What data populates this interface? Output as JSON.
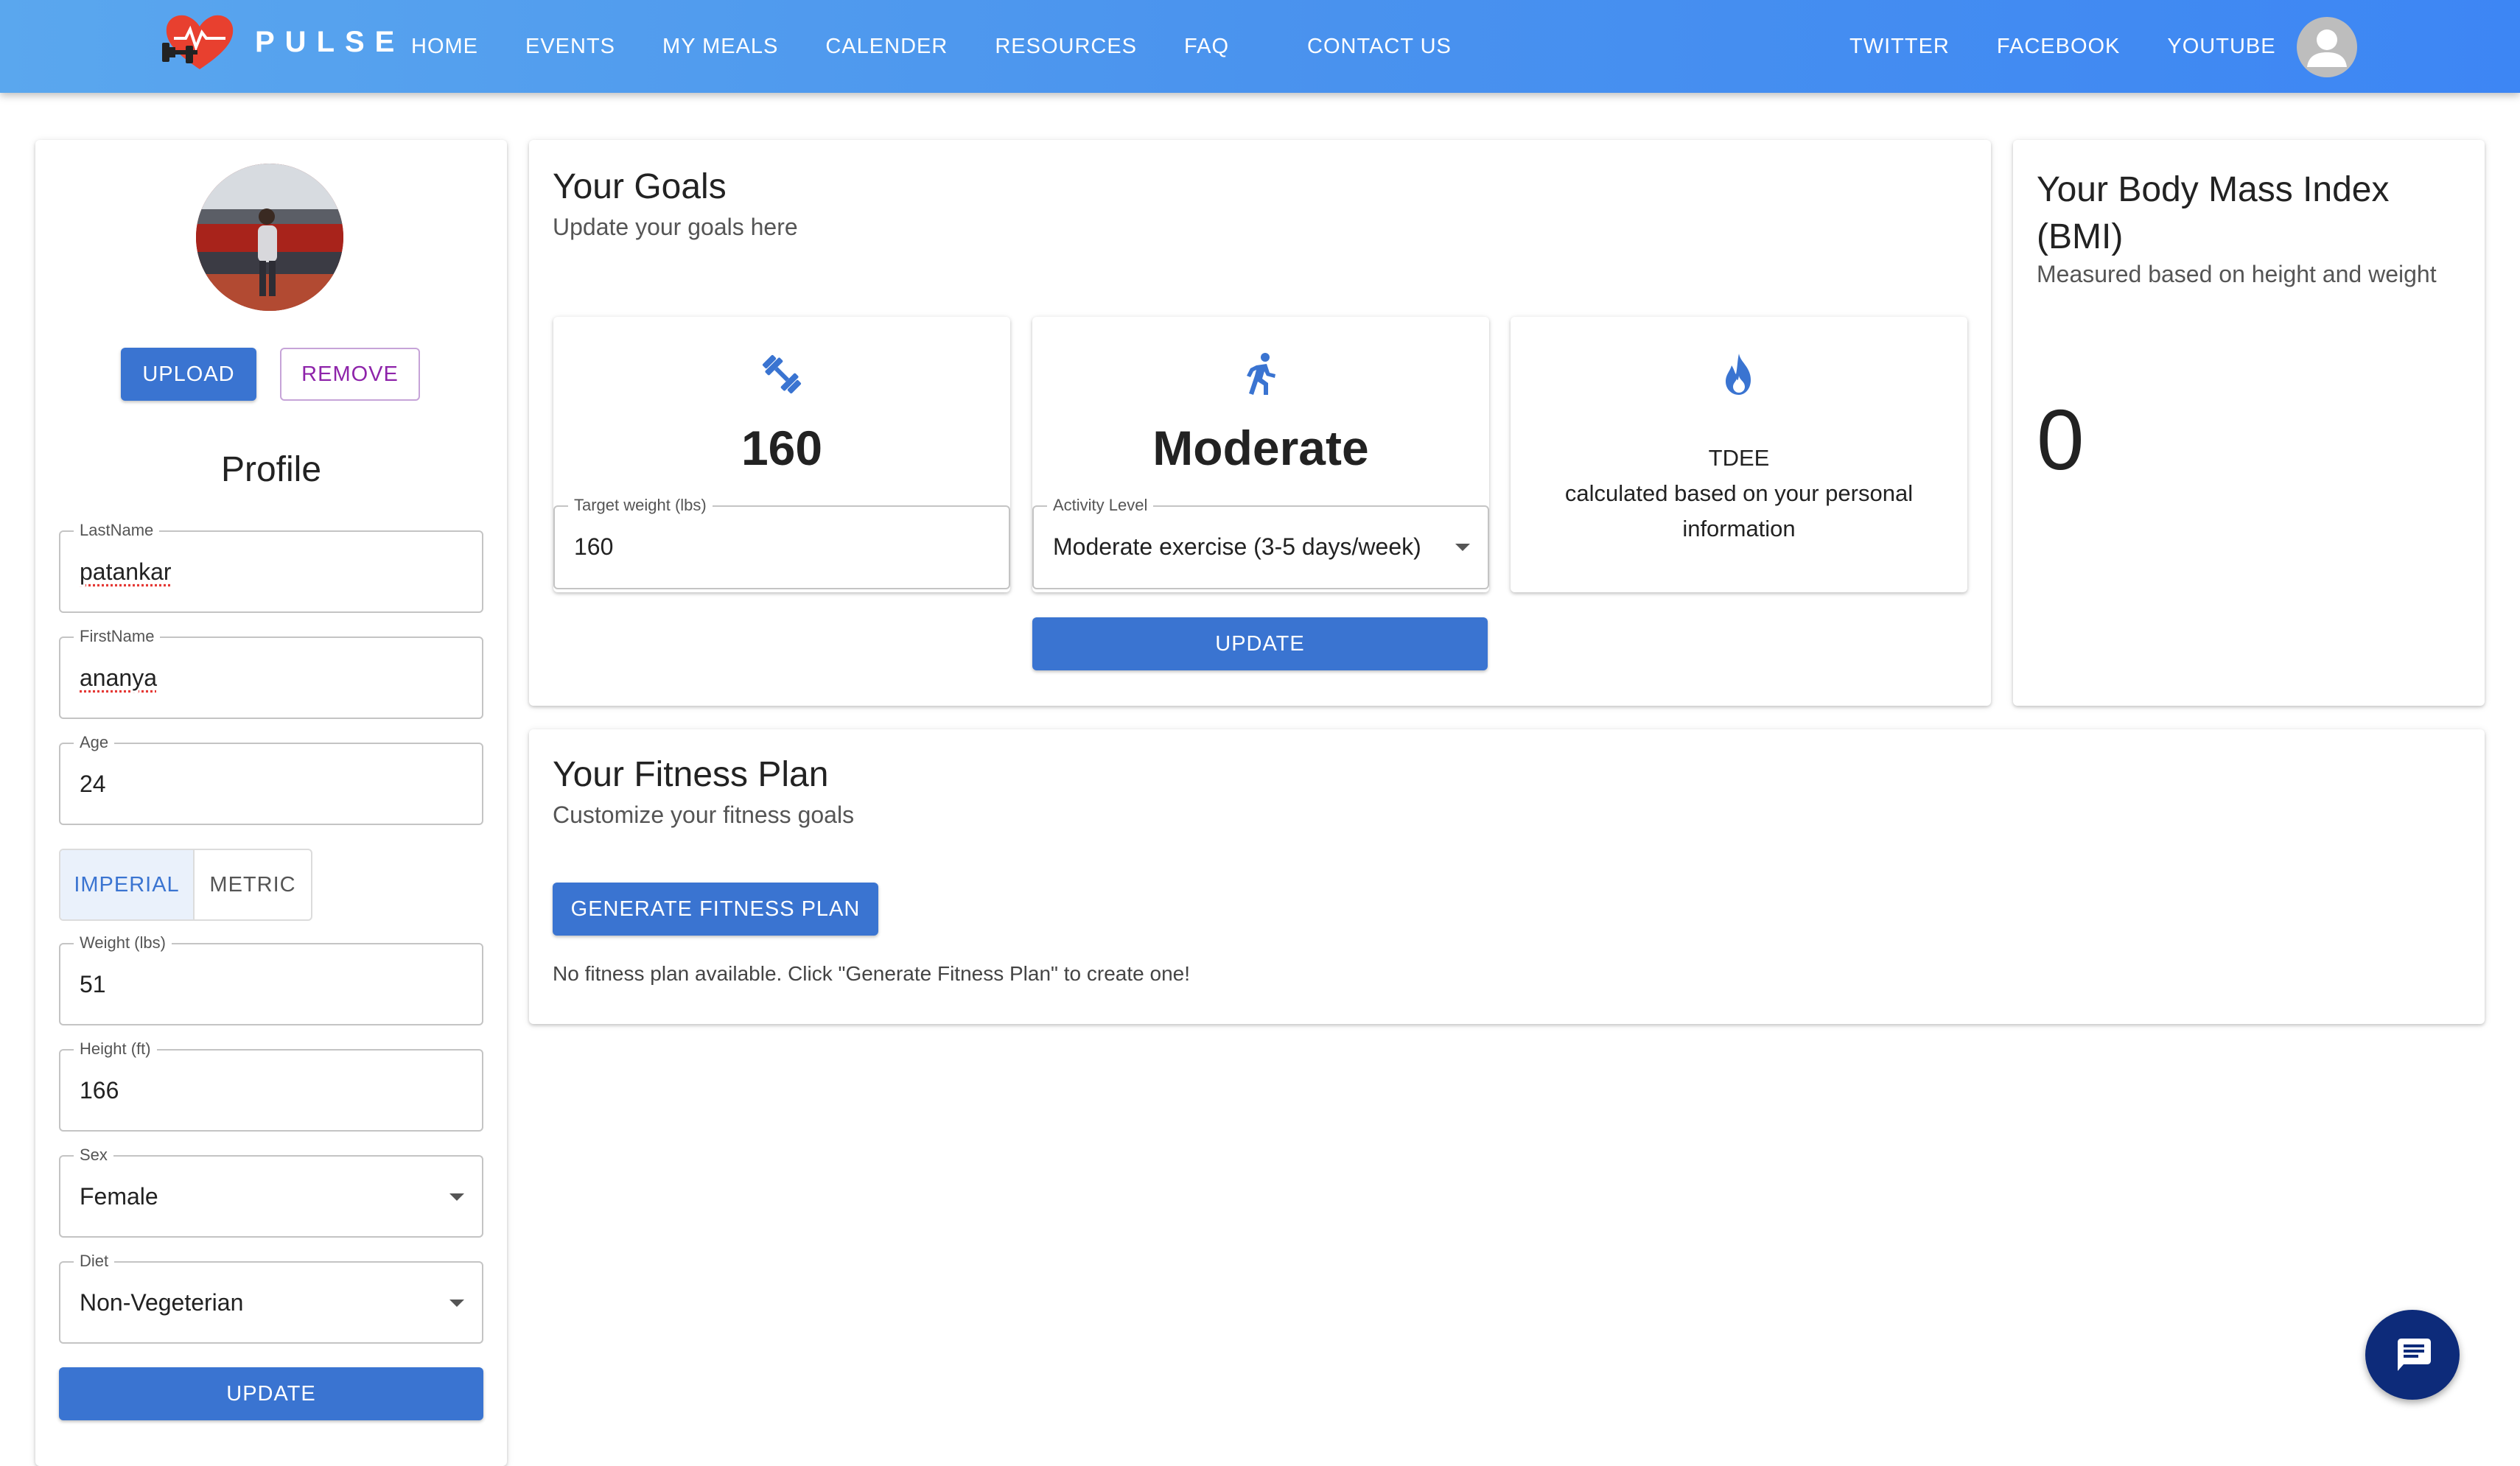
{
  "brand": {
    "name": "PULSE"
  },
  "nav": {
    "links": [
      "HOME",
      "EVENTS",
      "MY MEALS",
      "CALENDER",
      "RESOURCES",
      "FAQ"
    ],
    "contact": "CONTACT US",
    "social": [
      "TWITTER",
      "FACEBOOK",
      "YOUTUBE"
    ]
  },
  "profile": {
    "upload_label": "UPLOAD",
    "remove_label": "REMOVE",
    "title": "Profile",
    "last_name": {
      "label": "LastName",
      "value": "patankar"
    },
    "first_name": {
      "label": "FirstName",
      "value": "ananya"
    },
    "age": {
      "label": "Age",
      "value": "24"
    },
    "units": {
      "imperial": "IMPERIAL",
      "metric": "METRIC",
      "selected": "IMPERIAL"
    },
    "weight": {
      "label": "Weight (lbs)",
      "value": "51"
    },
    "height": {
      "label": "Height (ft)",
      "value": "166"
    },
    "sex": {
      "label": "Sex",
      "value": "Female"
    },
    "diet": {
      "label": "Diet",
      "value": "Non-Vegeterian"
    },
    "update_label": "UPDATE"
  },
  "goals": {
    "title": "Your Goals",
    "subtitle": "Update your goals here",
    "target": {
      "value_big": "160",
      "label": "Target weight (lbs)",
      "value": "160",
      "icon": "dumbbell-icon"
    },
    "activity": {
      "value_big": "Moderate",
      "label": "Activity Level",
      "value": "Moderate exercise (3-5 days/week)",
      "icon": "running-icon"
    },
    "tdee": {
      "title": "TDEE",
      "description": "calculated based on your personal information",
      "icon": "flame-icon"
    },
    "update_label": "UPDATE"
  },
  "bmi": {
    "title": "Your Body Mass Index (BMI)",
    "subtitle": "Measured based on height and weight",
    "value": "0"
  },
  "fitness": {
    "title": "Your Fitness Plan",
    "subtitle": "Customize your fitness goals",
    "generate_label": "GENERATE FITNESS PLAN",
    "message": "No fitness plan available. Click \"Generate Fitness Plan\" to create one!"
  },
  "colors": {
    "primary": "#3a74d1",
    "nav_gradient_start": "#5aa7ee",
    "nav_gradient_end": "#3d86f4",
    "chat_fab": "#0d2b7a",
    "remove_accent": "#8e24aa"
  }
}
